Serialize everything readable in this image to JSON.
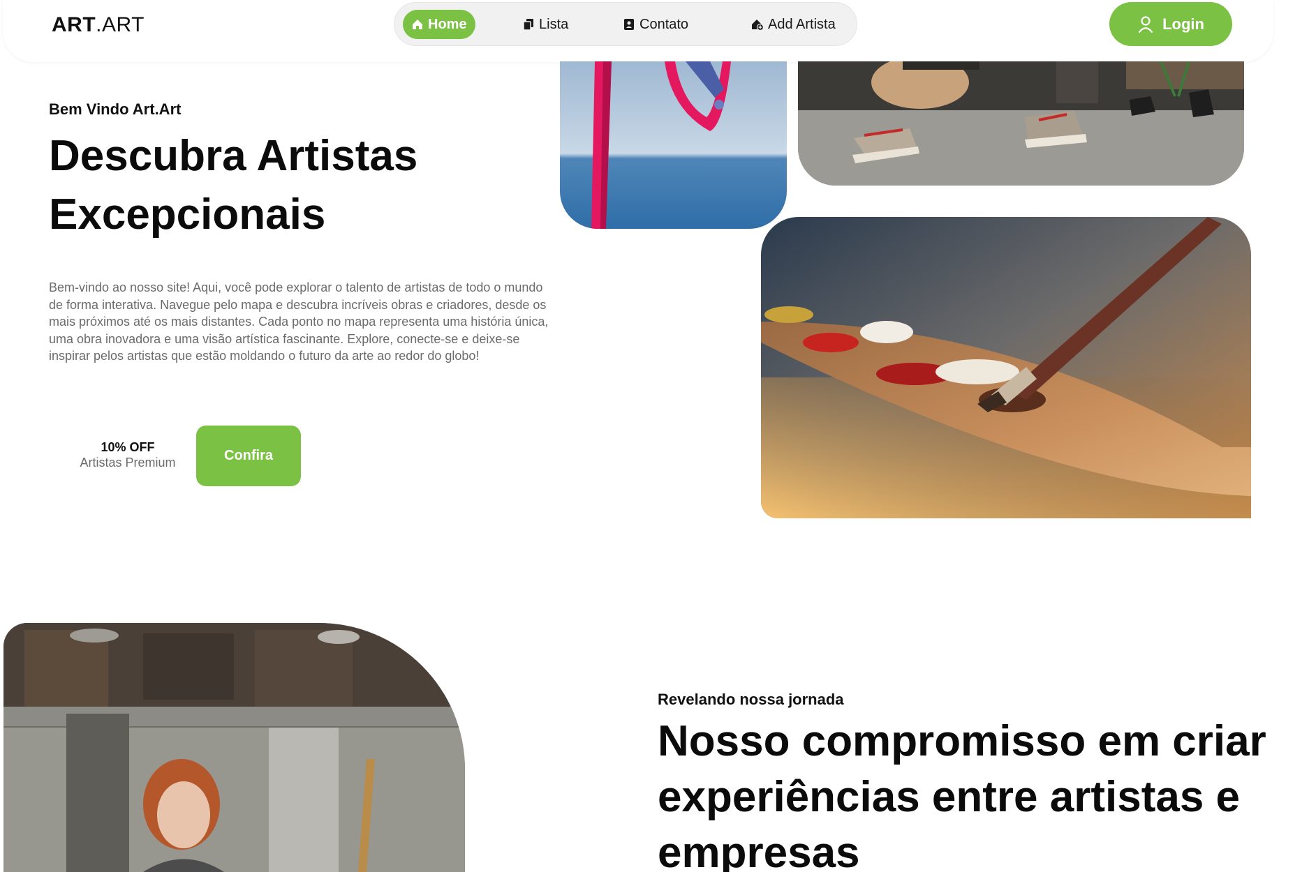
{
  "header": {
    "logo_bold": "ART",
    "logo_light": ".ART",
    "nav": [
      {
        "label": "Home",
        "icon": "home-icon",
        "active": true
      },
      {
        "label": "Lista",
        "icon": "copy-icon",
        "active": false
      },
      {
        "label": "Contato",
        "icon": "contact-card-icon",
        "active": false
      },
      {
        "label": "Add Artista",
        "icon": "home-add-icon",
        "active": false
      }
    ],
    "login_label": "Login",
    "login_icon": "user-icon"
  },
  "hero": {
    "kicker": "Bem Vindo Art.Art",
    "title": "Descubra Artistas Excepcionais",
    "text": "Bem-vindo ao nosso site! Aqui, você pode explorar o talento de artistas de todo o mundo de forma interativa. Navegue pelo mapa e descubra incríveis obras e criadores, desde os mais próximos até os mais distantes. Cada ponto no mapa representa uma história única, uma obra inovadora e uma visão artística fascinante. Explore, conecte-se e deixe-se inspirar pelos artistas que estão moldando o futuro da arte ao redor do globo!",
    "promo_main": "10% OFF",
    "promo_sub": "Artistas Premium",
    "cta_label": "Confira"
  },
  "section2": {
    "kicker": "Revelando nossa jornada",
    "title": "Nosso compromisso em criar experiências entre artistas e empresas"
  },
  "colors": {
    "accent": "#7bc143",
    "text_dark": "#0b0b0b",
    "text_muted": "#6b6b6b",
    "nav_bg": "#f1f1f1"
  }
}
